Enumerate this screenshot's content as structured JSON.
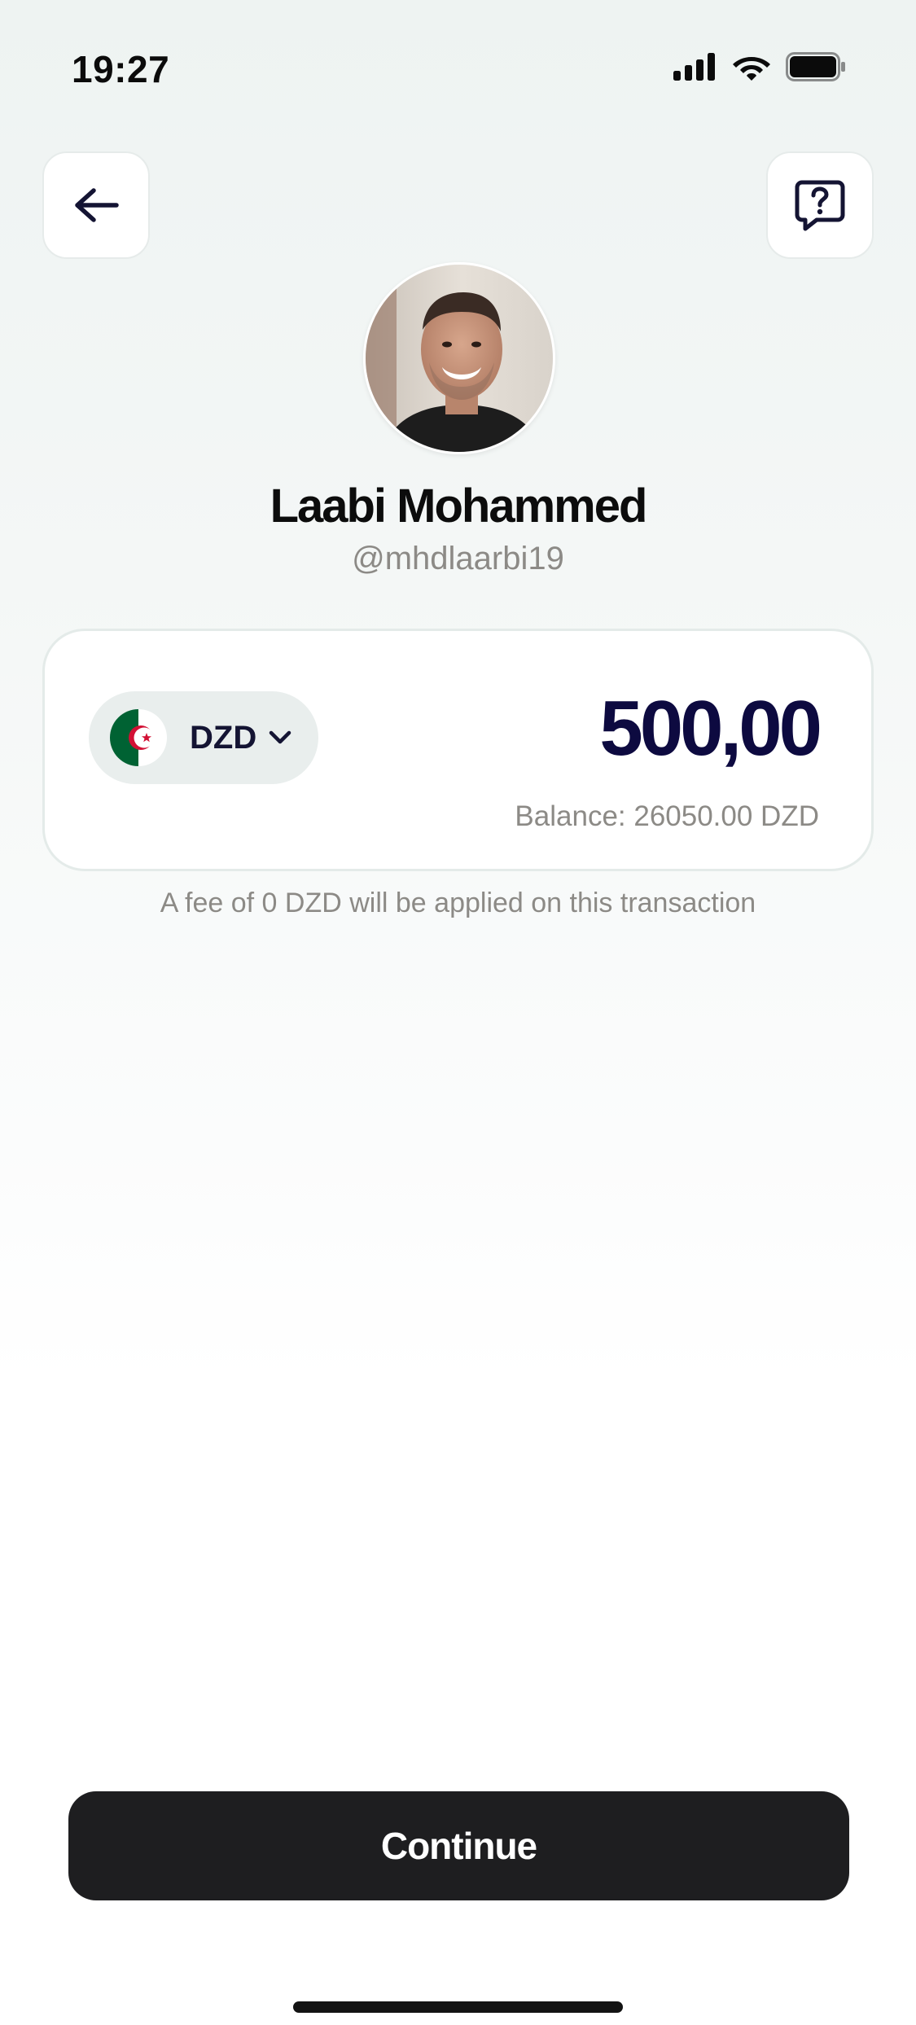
{
  "status_bar": {
    "time": "19:27",
    "icons": [
      "signal-icon",
      "wifi-icon",
      "battery-icon"
    ]
  },
  "header": {
    "back_icon": "arrow-left-icon",
    "help_icon": "question-chat-icon"
  },
  "recipient": {
    "name": "Laabi Mohammed",
    "handle": "@mhdlaarbi19"
  },
  "amount_card": {
    "currency_code": "DZD",
    "flag": "algeria-flag",
    "amount": "500,00",
    "balance": "Balance: 26050.00 DZD"
  },
  "fee_note": "A fee of 0 DZD will be applied on this transaction",
  "actions": {
    "continue_label": "Continue"
  },
  "colors": {
    "amount_text": "#0d0a40",
    "button_bg": "#1e1e20",
    "muted_text": "#8c8a86"
  }
}
